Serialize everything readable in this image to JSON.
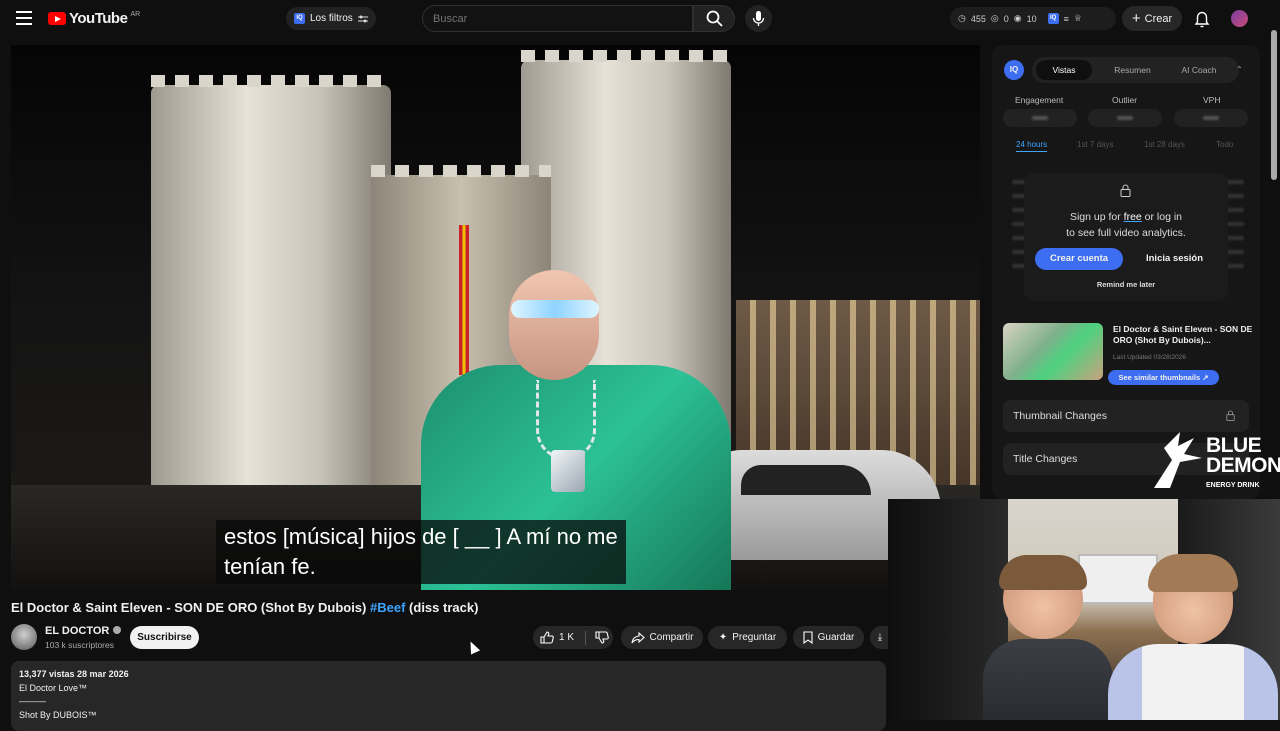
{
  "header": {
    "logo_text": "YouTube",
    "country_code": "AR",
    "filters_label": "Los filtros",
    "search_placeholder": "Buscar",
    "stats": {
      "views": "455",
      "likes": "0",
      "comments": "10"
    },
    "create_label": "Crear"
  },
  "video": {
    "subtitle_line1": "estos [música] hijos de [ __ ] A mí no me",
    "subtitle_line2": "tenían fe."
  },
  "title": {
    "main": "El Doctor & Saint Eleven - SON DE ORO (Shot By Dubois)",
    "hashtag": "#Beef",
    "suffix": "(diss track)"
  },
  "channel": {
    "name": "EL DOCTOR",
    "subscribers": "103 k suscriptores",
    "subscribe_label": "Suscribirse"
  },
  "actions": {
    "likes": "1 K",
    "share": "Compartir",
    "ask": "Preguntar",
    "save": "Guardar"
  },
  "description": {
    "meta": "13,377 vistas  28 mar 2026",
    "line1": "El Doctor Love™",
    "line2": "———",
    "line3": "Shot By DUBOIS™"
  },
  "panel": {
    "badge": "IQ",
    "tabs": [
      "Vistas",
      "Resumen",
      "AI Coach"
    ],
    "metrics": [
      "Engagement",
      "Outlier",
      "VPH"
    ],
    "ranges": [
      "24 hours",
      "1st 7 days",
      "1st 28 days",
      "Todo"
    ],
    "gate_line1_a": "Sign up for ",
    "gate_line1_free": "free",
    "gate_line1_b": " or log in",
    "gate_line2": "to see full video analytics.",
    "create_account": "Crear cuenta",
    "login": "Inicia sesión",
    "remind": "Remind me later",
    "similar_title": "El Doctor & Saint Eleven - SON DE ORO (Shot By Dubois)...",
    "similar_updated": "Last Updated 03/28/2026",
    "similar_button": "See similar thumbnails ↗",
    "rows": [
      "Thumbnail Changes",
      "Title Changes"
    ]
  },
  "sponsor": {
    "name": "BLUE DEMON",
    "tagline": "ENERGY DRINK"
  }
}
